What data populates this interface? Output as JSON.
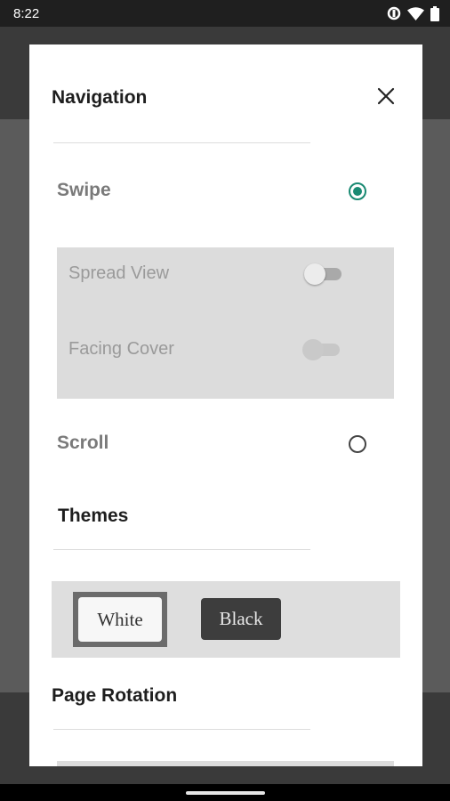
{
  "status_bar": {
    "time": "8:22",
    "icons": [
      "data-saver-icon",
      "wifi-icon",
      "battery-icon"
    ]
  },
  "dialog": {
    "navigation": {
      "title": "Navigation",
      "options": [
        {
          "label": "Swipe",
          "selected": true
        },
        {
          "label": "Scroll",
          "selected": false
        }
      ],
      "sub_options": [
        {
          "label": "Spread View",
          "enabled": false,
          "on": false
        },
        {
          "label": "Facing Cover",
          "enabled": false,
          "on": false
        }
      ]
    },
    "themes": {
      "title": "Themes",
      "items": [
        {
          "label": "White",
          "selected": true
        },
        {
          "label": "Black",
          "selected": false
        }
      ]
    },
    "page_rotation": {
      "title": "Page Rotation"
    },
    "close_icon": "close-icon"
  },
  "colors": {
    "accent": "#1a8a73",
    "scrim": "#5b5b5b",
    "panel": "#dcdcdc"
  }
}
